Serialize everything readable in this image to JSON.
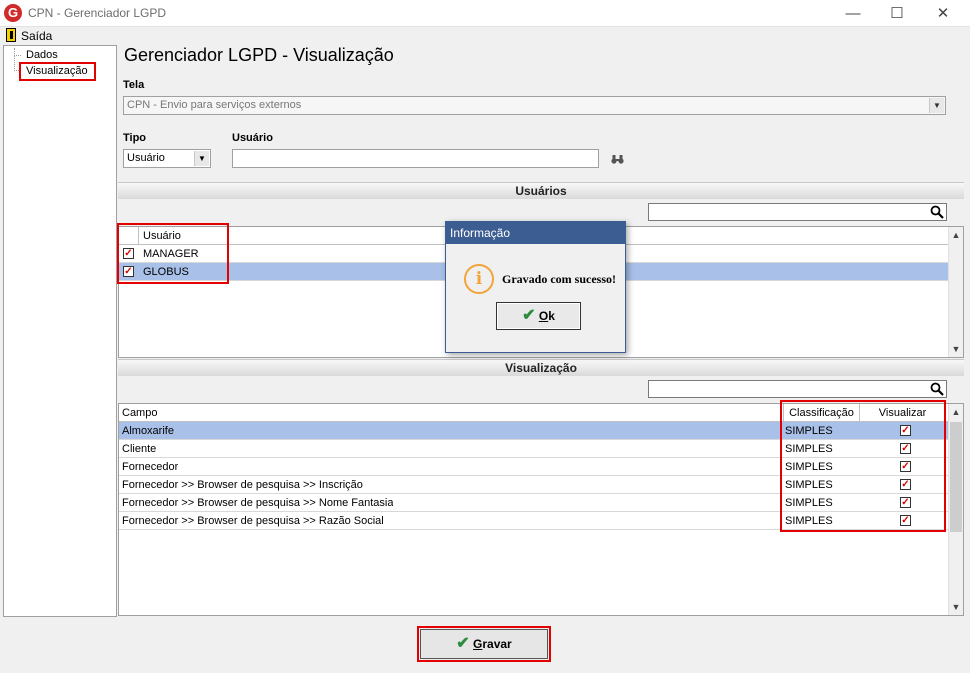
{
  "window": {
    "logo_letter": "G",
    "title": "CPN - Gerenciador LGPD",
    "minimize_glyph": "—",
    "maximize_glyph": "☐",
    "close_glyph": "✕"
  },
  "menu": {
    "exit_label": "Saída",
    "exit_icon": "exit-door-icon"
  },
  "tree": {
    "items": [
      {
        "label": "Dados"
      },
      {
        "label": "Visualização"
      }
    ]
  },
  "page_title": "Gerenciador LGPD - Visualização",
  "form": {
    "tela_label": "Tela",
    "tela_value": "CPN - Envio para serviços externos",
    "tipo_label": "Tipo",
    "tipo_value": "Usuário",
    "usuario_label": "Usuário",
    "usuario_value": "",
    "search_icon": "binoculars-icon"
  },
  "users_section": {
    "title": "Usuários",
    "search_value": "",
    "column_header": "Usuário",
    "rows": [
      {
        "name": "MANAGER",
        "checked": true
      },
      {
        "name": "GLOBUS",
        "checked": true
      }
    ]
  },
  "visualization_section": {
    "title": "Visualização",
    "search_value": "",
    "headers": {
      "campo": "Campo",
      "classificacao": "Classificação",
      "visualizar": "Visualizar"
    },
    "rows": [
      {
        "campo": "Almoxarife",
        "classificacao": "SIMPLES",
        "visualizar": true
      },
      {
        "campo": "Cliente",
        "classificacao": "SIMPLES",
        "visualizar": true
      },
      {
        "campo": "Fornecedor",
        "classificacao": "SIMPLES",
        "visualizar": true
      },
      {
        "campo": "Fornecedor >> Browser de pesquisa >> Inscrição",
        "classificacao": "SIMPLES",
        "visualizar": true
      },
      {
        "campo": "Fornecedor >> Browser de pesquisa >> Nome Fantasia",
        "classificacao": "SIMPLES",
        "visualizar": true
      },
      {
        "campo": "Fornecedor >> Browser de pesquisa >> Razão Social",
        "classificacao": "SIMPLES",
        "visualizar": true
      }
    ]
  },
  "dialog": {
    "title": "Informação",
    "message": "Gravado com sucesso!",
    "icon": "info-icon",
    "ok_label_first": "O",
    "ok_label_rest": "k"
  },
  "save_button": {
    "label_first": "G",
    "label_rest": "ravar"
  },
  "colors": {
    "selection": "#a9c0e8",
    "highlight_border": "#e30000",
    "dialog_title": "#3c5d91",
    "check_mark": "#d00000"
  }
}
